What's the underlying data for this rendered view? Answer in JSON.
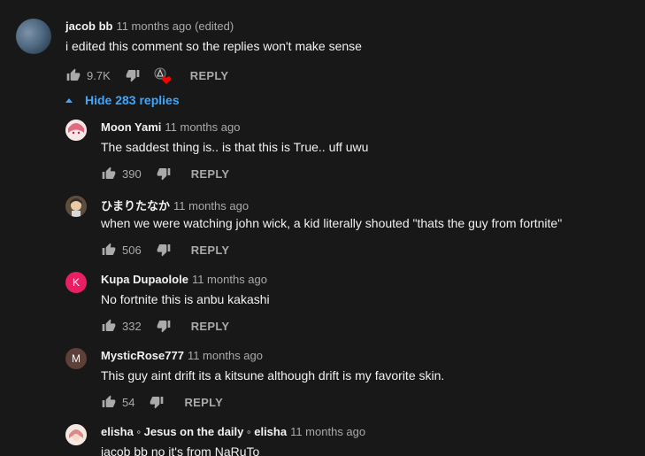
{
  "main_comment": {
    "author": "jacob bb",
    "time": "11 months ago (edited)",
    "text": "i edited this comment so the replies won't make sense",
    "likes": "9.7K",
    "reply_label": "REPLY"
  },
  "hide_replies": {
    "label": "Hide 283 replies"
  },
  "replies": [
    {
      "author": "Moon Yami",
      "time": "11 months ago",
      "text": "The saddest thing is.. is that this is True.. uff uwu",
      "likes": "390",
      "reply_label": "REPLY"
    },
    {
      "author": "ひまりたなか",
      "time": "11 months ago",
      "text": "when we were watching john wick, a kid literally shouted \"thats the guy from fortnite\"",
      "likes": "506",
      "reply_label": "REPLY"
    },
    {
      "author": "Kupa Dupaolole",
      "time": "11 months ago",
      "text": "No fortnite this is anbu kakashi",
      "likes": "332",
      "reply_label": "REPLY",
      "avatar_letter": "K",
      "avatar_color": "#e91e63"
    },
    {
      "author": "MysticRose777",
      "time": "11 months ago",
      "text": "This guy aint drift its a kitsune although drift is my favorite skin.",
      "likes": "54",
      "reply_label": "REPLY",
      "avatar_letter": "M",
      "avatar_color": "#5d4037"
    },
    {
      "author": "elisha ◦ Jesus on the daily ◦ elisha",
      "time": "11 months ago",
      "text": "jacob bb no it's from NaRuTo"
    }
  ],
  "icons": {
    "like": "thumbs-up-icon",
    "dislike": "thumbs-down-icon",
    "collapse": "caret-up-icon",
    "heart": "creator-heart-icon"
  },
  "colors": {
    "background": "#181818",
    "link_blue": "#3ea6ff",
    "heart_red": "#ff0000"
  }
}
